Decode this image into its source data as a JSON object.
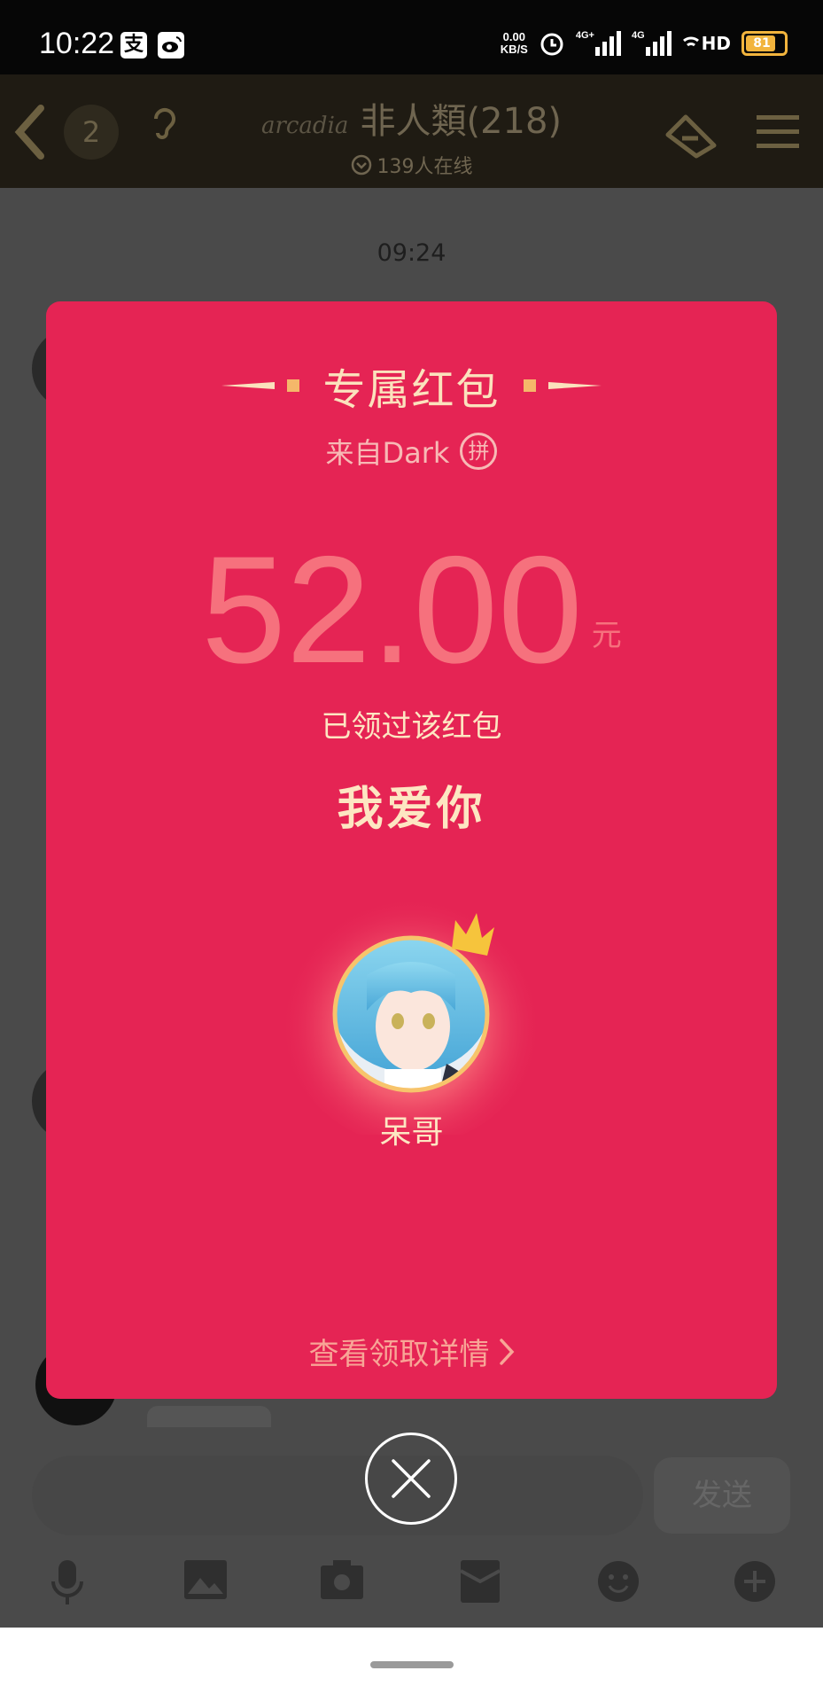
{
  "status_bar": {
    "time": "10:22",
    "app_icon_1": "支",
    "net_speed_value": "0.00",
    "net_speed_unit": "KB/S",
    "sim1_tag": "4G+",
    "sim2_tag": "4G",
    "hd_tag": "HD",
    "battery_level": "81"
  },
  "header": {
    "unread_count": "2",
    "group_prefix": "arcadia",
    "group_title": "非人類(218)",
    "online_text": "139人在线"
  },
  "chat": {
    "timestamp": "09:24"
  },
  "red_packet": {
    "title": "专属红包",
    "from": "来自Dark",
    "from_badge": "拼",
    "amount": "52.00",
    "unit": "元",
    "status": "已领过该红包",
    "message": "我爱你",
    "sender_name": "呆哥",
    "details_link": "查看领取详情"
  },
  "composer": {
    "send_label": "发送"
  },
  "colors": {
    "packet_red": "#e52454",
    "gold_text": "#fde6c2",
    "amount_pink": "#f6717d"
  },
  "icons": [
    "back-chevron-icon",
    "ear-icon",
    "ticket-icon",
    "menu-icon",
    "online-chevron-icon",
    "pin-icon",
    "crown-icon",
    "close-icon",
    "mic-icon",
    "image-icon",
    "camera-icon",
    "red-envelope-icon",
    "emoji-icon",
    "plus-icon"
  ]
}
